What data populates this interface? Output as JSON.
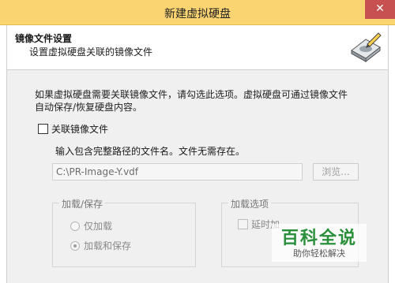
{
  "window": {
    "title": "新建虚拟硬盘",
    "close_glyph": "✕"
  },
  "header": {
    "title": "镜像文件设置",
    "subtitle": "设置虚拟硬盘关联的镜像文件",
    "icon": "disk-image-icon"
  },
  "main": {
    "description_line1": "如果虚拟硬盘需要关联镜像文件，请勾选此选项。虚拟硬盘可通过镜像文件",
    "description_line2": "自动保存/恢复硬盘内容。",
    "associate_checkbox_label": "关联镜像文件",
    "associate_checked": false,
    "path_hint": "输入包含完整路径的文件名。文件无需存在。",
    "path_value": "C:\\PR-Image-Y.vdf",
    "browse_label": "浏览..."
  },
  "load_group": {
    "label": "加载/保存",
    "options": [
      {
        "label": "仅加载",
        "checked": false
      },
      {
        "label": "加载和保存",
        "checked": true
      }
    ]
  },
  "options_group": {
    "label": "加载选项",
    "delay_label": "延时加"
  },
  "watermark": {
    "title": "百科全说",
    "subtitle": "助你轻松解决"
  }
}
